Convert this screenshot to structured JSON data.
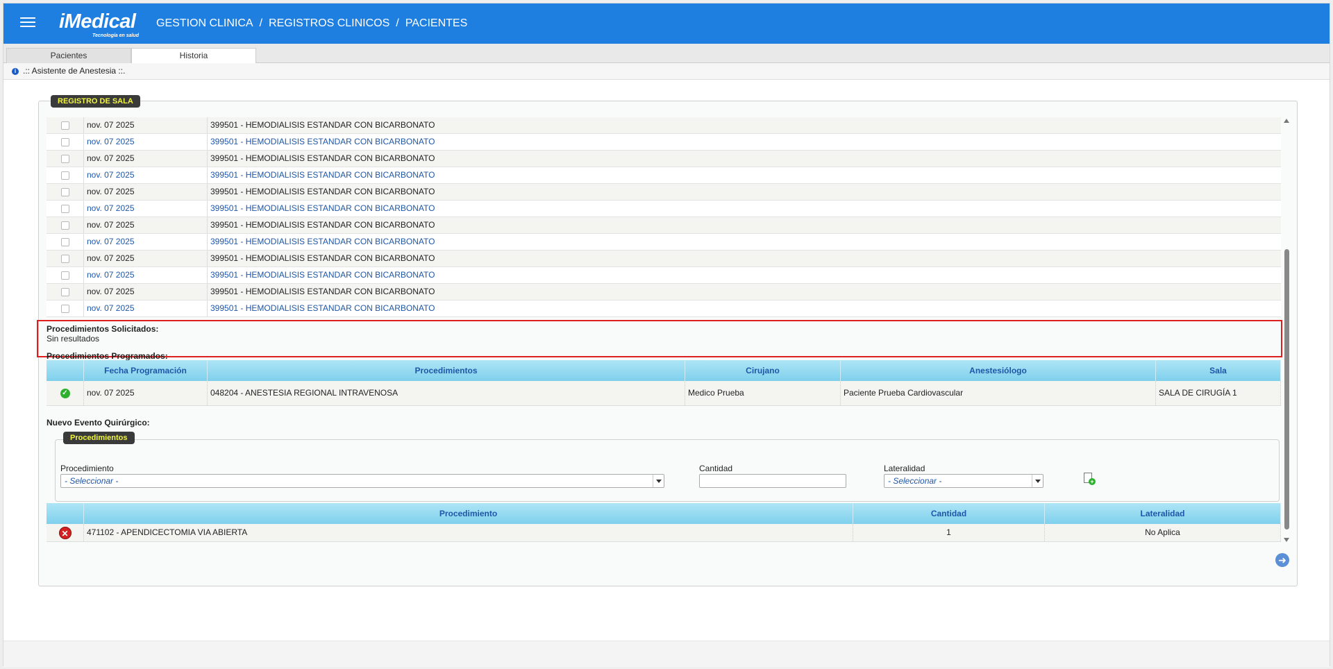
{
  "header": {
    "logo_text": "iMedical",
    "logo_tagline": "Tecnología en salud",
    "breadcrumbs": [
      "GESTION CLINICA",
      "REGISTROS CLINICOS",
      "PACIENTES"
    ],
    "separator": "/"
  },
  "tabs": [
    {
      "label": "Pacientes",
      "active": false
    },
    {
      "label": "Historia",
      "active": true
    }
  ],
  "assistant": {
    "title": ".:: Asistente de Anestesia ::."
  },
  "sala": {
    "legend": "REGISTRO DE SALA",
    "rows": [
      {
        "date": "nov. 07 2025",
        "procedure": "399501 - HEMODIALISIS ESTANDAR CON BICARBONATO"
      },
      {
        "date": "nov. 07 2025",
        "procedure": "399501 - HEMODIALISIS ESTANDAR CON BICARBONATO"
      },
      {
        "date": "nov. 07 2025",
        "procedure": "399501 - HEMODIALISIS ESTANDAR CON BICARBONATO"
      },
      {
        "date": "nov. 07 2025",
        "procedure": "399501 - HEMODIALISIS ESTANDAR CON BICARBONATO"
      },
      {
        "date": "nov. 07 2025",
        "procedure": "399501 - HEMODIALISIS ESTANDAR CON BICARBONATO"
      },
      {
        "date": "nov. 07 2025",
        "procedure": "399501 - HEMODIALISIS ESTANDAR CON BICARBONATO"
      },
      {
        "date": "nov. 07 2025",
        "procedure": "399501 - HEMODIALISIS ESTANDAR CON BICARBONATO"
      },
      {
        "date": "nov. 07 2025",
        "procedure": "399501 - HEMODIALISIS ESTANDAR CON BICARBONATO"
      },
      {
        "date": "nov. 07 2025",
        "procedure": "399501 - HEMODIALISIS ESTANDAR CON BICARBONATO"
      },
      {
        "date": "nov. 07 2025",
        "procedure": "399501 - HEMODIALISIS ESTANDAR CON BICARBONATO"
      },
      {
        "date": "nov. 07 2025",
        "procedure": "399501 - HEMODIALISIS ESTANDAR CON BICARBONATO"
      },
      {
        "date": "nov. 07 2025",
        "procedure": "399501 - HEMODIALISIS ESTANDAR CON BICARBONATO"
      }
    ],
    "solicitados_label": "Procedimientos Solicitados:",
    "solicitados_empty": "Sin resultados",
    "programados_label": "Procedimientos Programados:",
    "programados_headers": [
      "Fecha Programación",
      "Procedimientos",
      "Cirujano",
      "Anestesiólogo",
      "Sala"
    ],
    "programados_row": {
      "date": "nov. 07 2025",
      "procedure": "048204 - ANESTESIA REGIONAL INTRAVENOSA",
      "surgeon": "Medico Prueba",
      "anesthesiologist": "Paciente Prueba Cardiovascular",
      "room": "SALA DE CIRUGÍA 1"
    },
    "nuevo_label": "Nuevo Evento Quirúrgico:"
  },
  "form": {
    "legend": "Procedimientos",
    "procedimiento_label": "Procedimiento",
    "procedimiento_value": "- Seleccionar -",
    "cantidad_label": "Cantidad",
    "cantidad_value": "",
    "lateralidad_label": "Lateralidad",
    "lateralidad_value": "- Seleccionar -"
  },
  "added": {
    "headers": [
      "Procedimiento",
      "Cantidad",
      "Lateralidad"
    ],
    "row": {
      "procedure": "471102 - APENDICECTOMIA VIA ABIERTA",
      "quantity": "1",
      "laterality": "No Aplica"
    }
  },
  "colors": {
    "header_blue": "#1e7fe0",
    "legend_bg": "#3a3a3a",
    "legend_text": "#f1f541",
    "grid_header": "#7fd0ec",
    "highlight_red": "#dd1f1f",
    "link_blue": "#1e56a8"
  }
}
